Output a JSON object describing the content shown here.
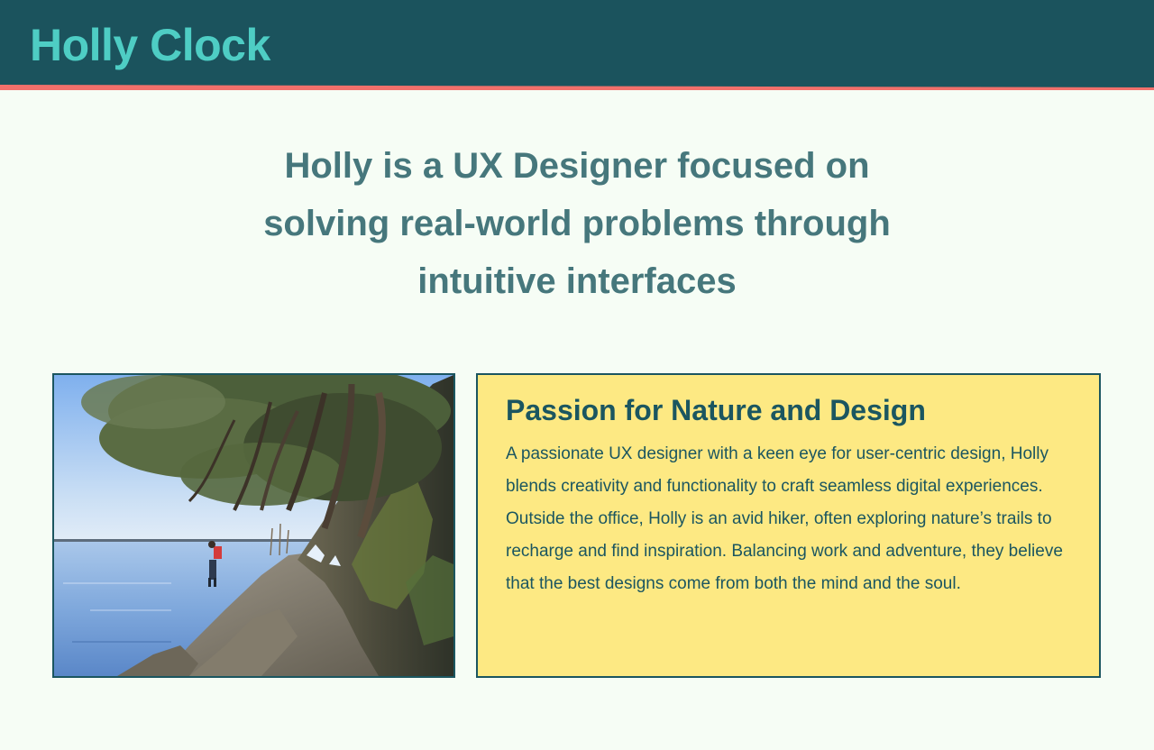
{
  "header": {
    "brand": "Holly Clock"
  },
  "hero": {
    "lines": [
      "Holly is a UX Designer focused on",
      "solving real-world problems through",
      "intuitive interfaces"
    ]
  },
  "about": {
    "heading": "Passion for Nature and Design",
    "body": "A passionate UX designer with a keen eye for user-centric design, Holly blends creativity and functionality to craft seamless digital experiences. Outside the office, Holly is an avid hiker, often exploring nature’s trails to recharge and find inspiration. Balancing work and adventure, they believe that the best designs come from both the mind and the soul."
  },
  "colors": {
    "header_bg": "#1b535d",
    "accent_line": "#f2706b",
    "brand": "#4ecdc4",
    "hero_text": "#46777c",
    "card_bg": "#fde983",
    "card_border": "#1b5660",
    "page_bg": "#f6fdf5"
  }
}
